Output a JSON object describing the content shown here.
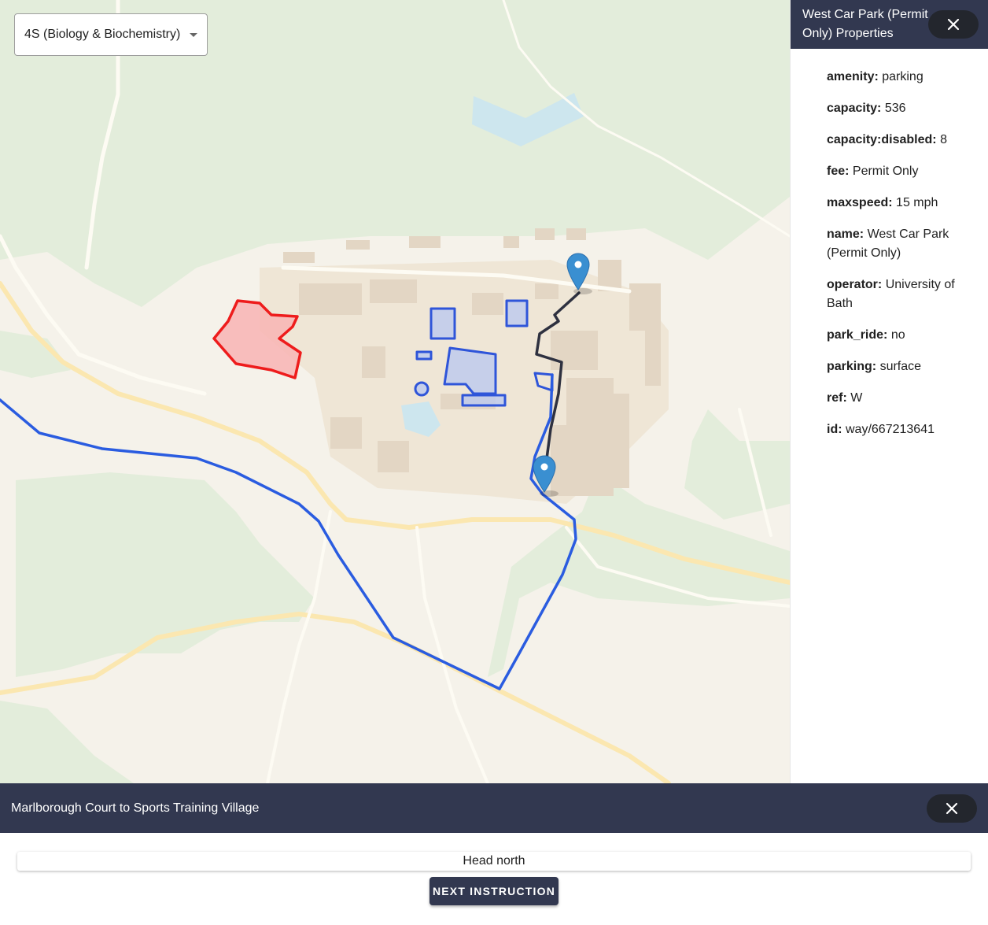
{
  "building_select": {
    "value": "4S (Biology & Biochemistry)"
  },
  "properties_panel": {
    "title": "West Car Park (Permit Only) Properties",
    "properties": [
      {
        "key": "amenity:",
        "value": "parking"
      },
      {
        "key": "capacity:",
        "value": "536"
      },
      {
        "key": "capacity:disabled:",
        "value": "8"
      },
      {
        "key": "fee:",
        "value": "Permit Only"
      },
      {
        "key": "maxspeed:",
        "value": "15 mph"
      },
      {
        "key": "name:",
        "value": "West Car Park (Permit Only)"
      },
      {
        "key": "operator:",
        "value": "University of Bath"
      },
      {
        "key": "park_ride:",
        "value": "no"
      },
      {
        "key": "parking:",
        "value": "surface"
      },
      {
        "key": "ref:",
        "value": "W"
      },
      {
        "key": "id:",
        "value": "way/667213641"
      }
    ]
  },
  "directions": {
    "title": "Marlborough Court to Sports Training Village",
    "current_instruction": "Head north",
    "next_label": "Next Instruction"
  },
  "map": {
    "colors": {
      "background": "#f5f2ea",
      "wood": "#e3eddb",
      "building": "#e3d6c4",
      "road": "#fdfbf3",
      "road_major": "#fbe7b0",
      "water": "#cde6ee",
      "route_blue": "#2a5ce0",
      "route_dark": "#2e3140",
      "highlight_red": "#ee1c1c",
      "highlight_fill": "#f8b4b4",
      "building_outline": "#2f55d9",
      "building_fill": "#bcc9ef",
      "marker": "#3a8fd1"
    }
  }
}
